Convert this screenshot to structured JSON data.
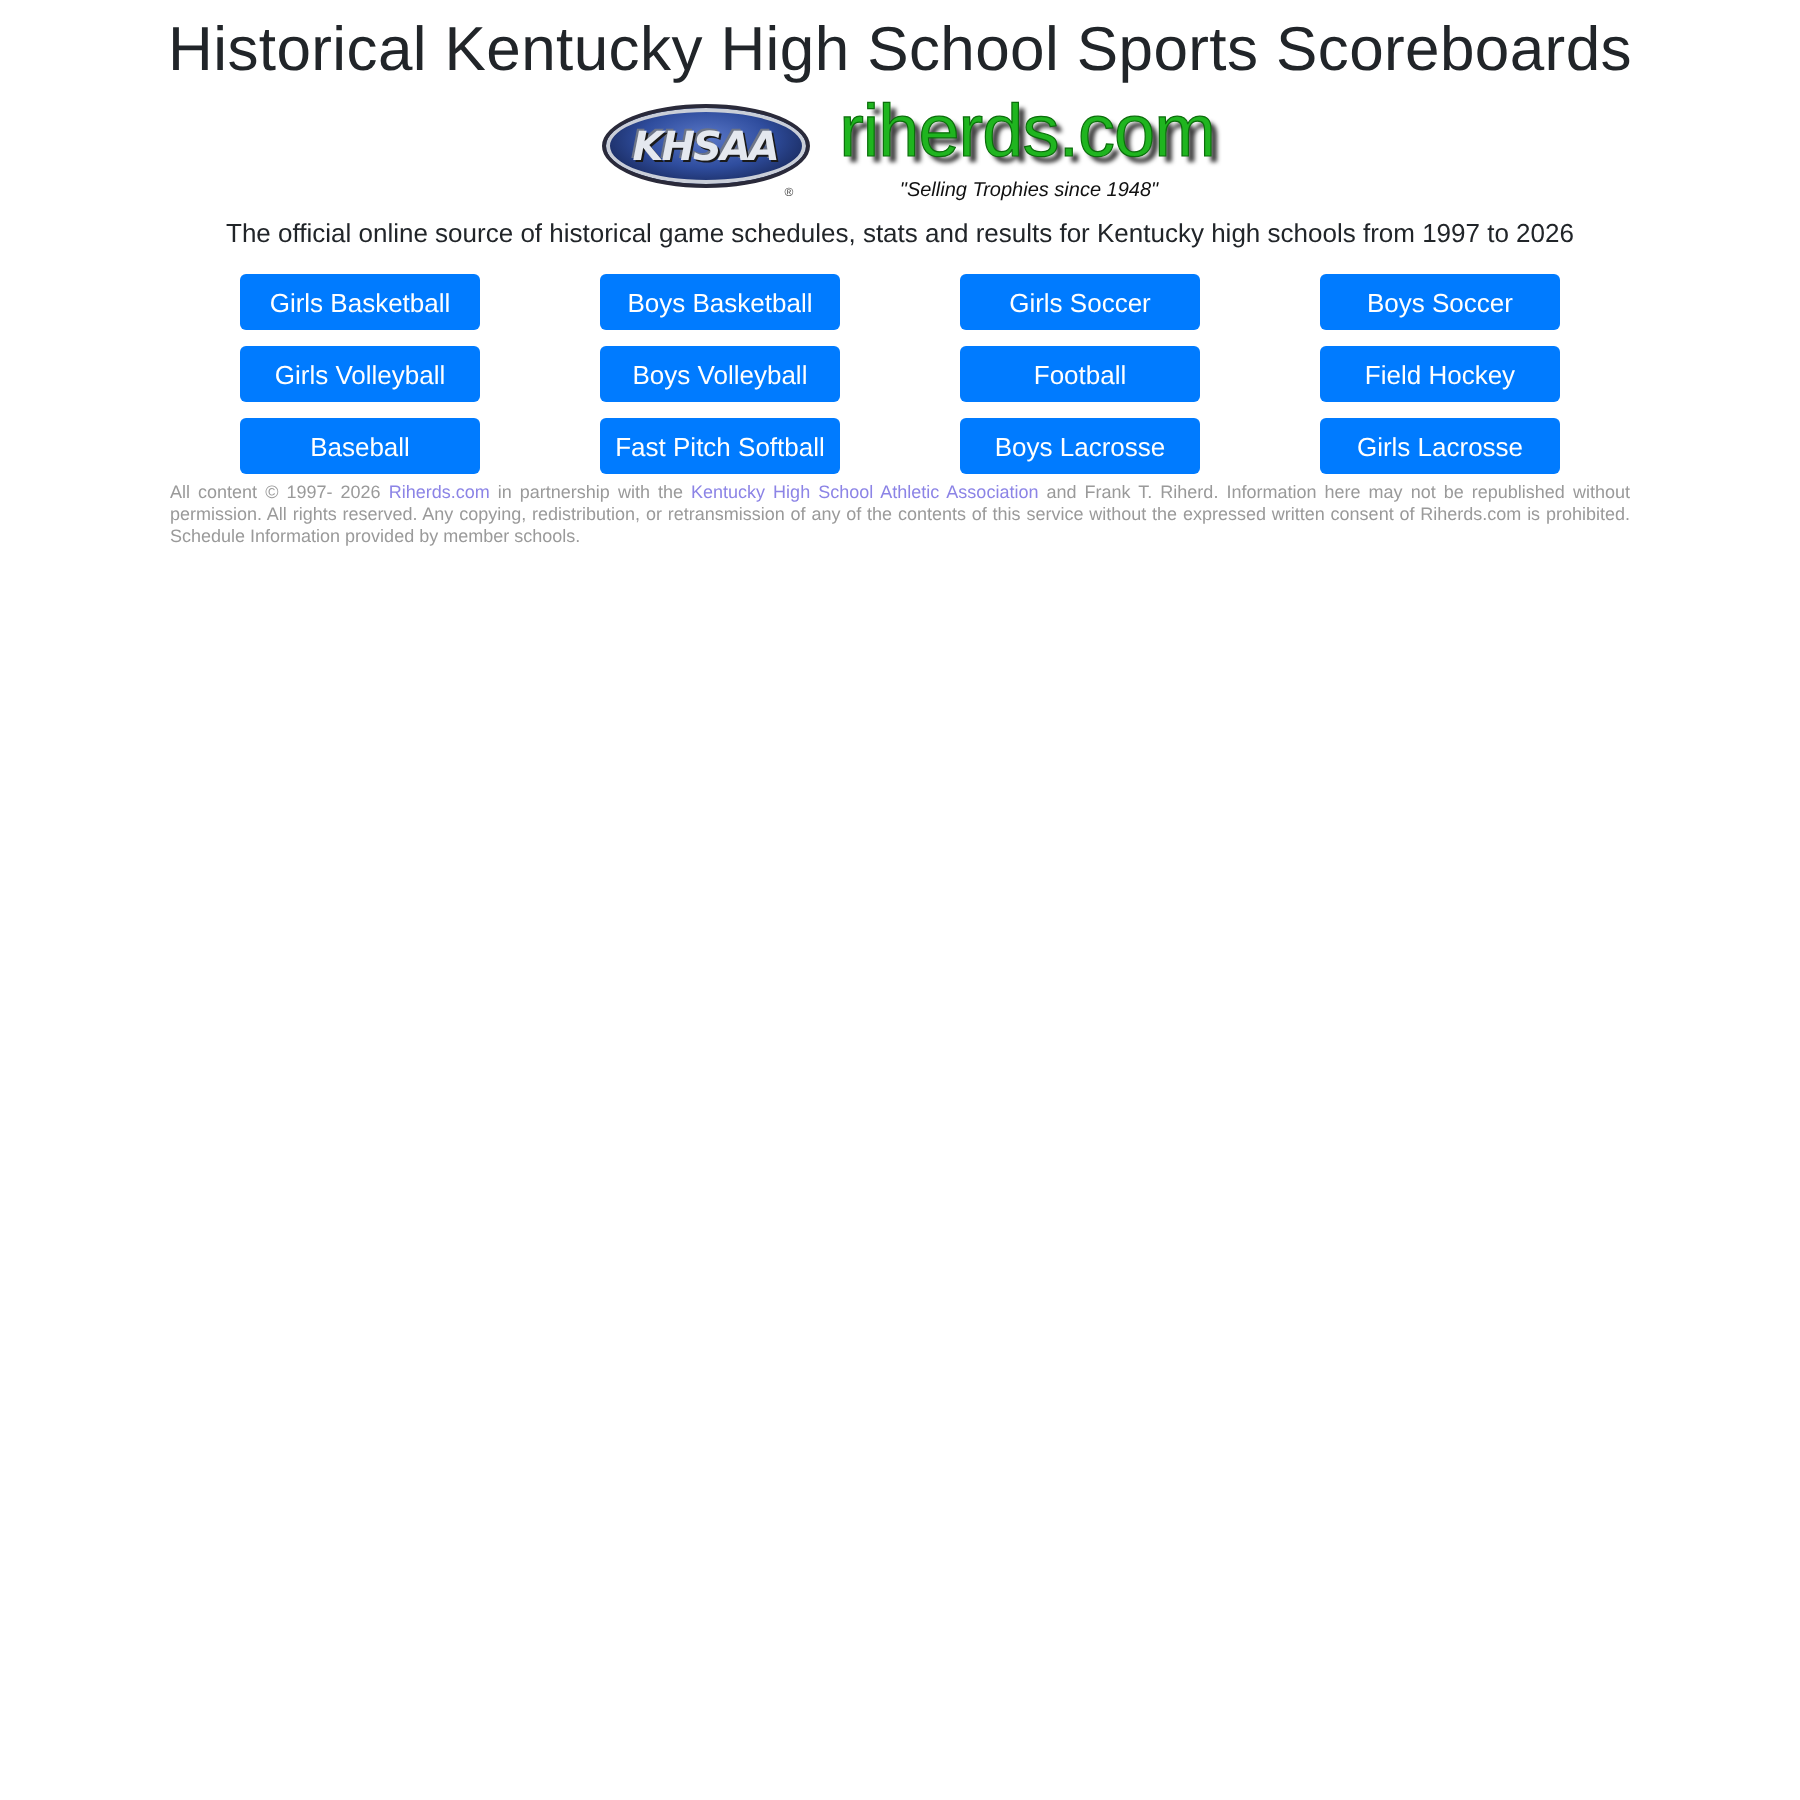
{
  "page": {
    "title": "Historical Kentucky High School Sports Scoreboards"
  },
  "logos": {
    "khsaa": {
      "text": "KHSAA",
      "mark": "®"
    },
    "riherds": {
      "text": "riherds.com",
      "tagline": "\"Selling Trophies since 1948\""
    }
  },
  "subtitle": "The official online source of historical game schedules, stats and results for Kentucky high schools from 1997 to 2026",
  "sports": [
    "Girls Basketball",
    "Boys Basketball",
    "Girls Soccer",
    "Boys Soccer",
    "Girls Volleyball",
    "Boys Volleyball",
    "Football",
    "Field Hockey",
    "Baseball",
    "Fast Pitch Softball",
    "Boys Lacrosse",
    "Girls Lacrosse"
  ],
  "footer": {
    "parts": [
      {
        "kind": "text",
        "text": "All content © 1997- 2026 "
      },
      {
        "kind": "link",
        "text": "Riherds.com"
      },
      {
        "kind": "text",
        "text": " in partnership with the "
      },
      {
        "kind": "link",
        "text": "Kentucky High School Athletic Association"
      },
      {
        "kind": "text",
        "text": " and Frank T. Riherd. Information here may not be republished without permission. All rights reserved. Any copying, redistribution, or retransmission of any of the contents of this service without the expressed written consent of Riherds.com is prohibited. Schedule Information provided by member schools."
      }
    ]
  }
}
